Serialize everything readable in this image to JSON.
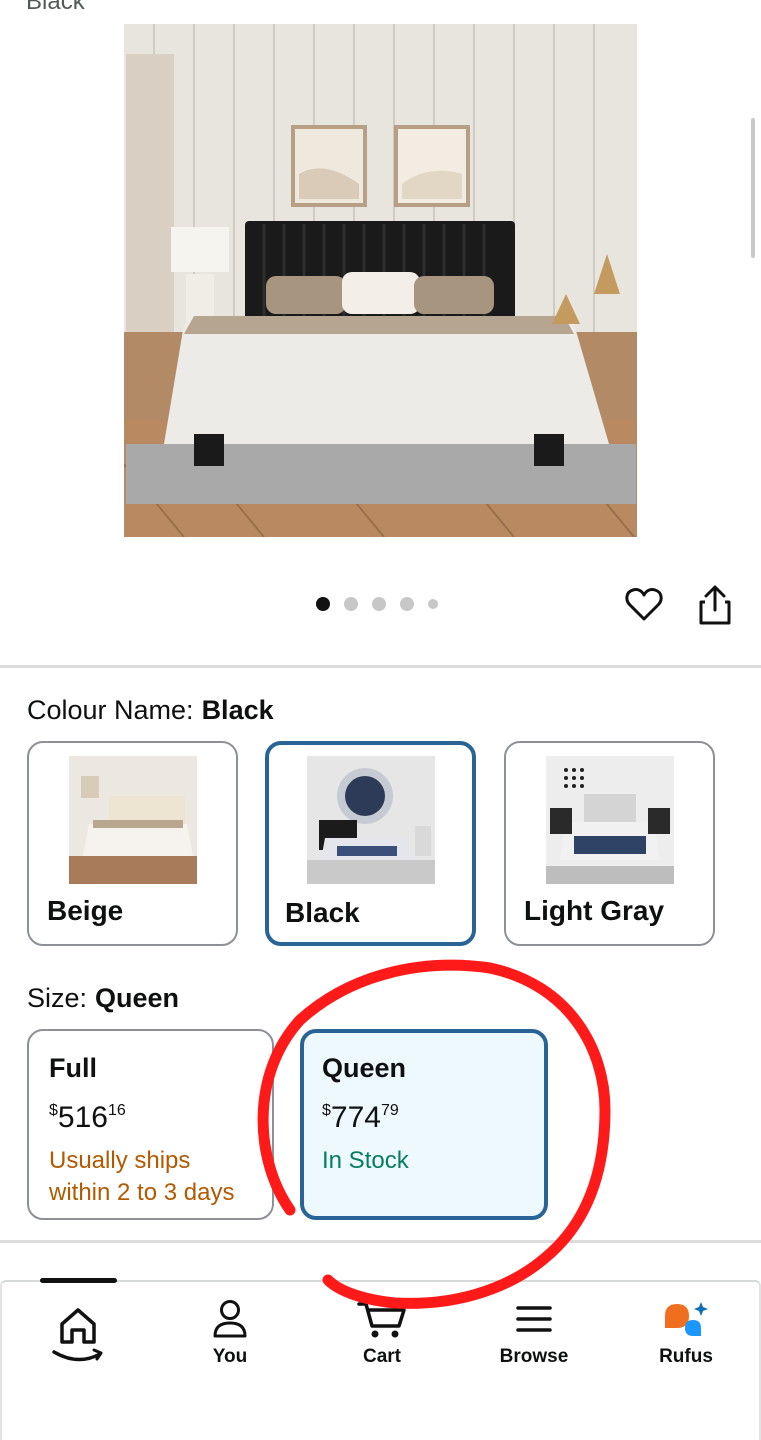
{
  "header": {
    "cut_off_text": "Black"
  },
  "gallery": {
    "image_count": 5,
    "active_index": 0
  },
  "actions": {
    "wishlist_icon": "heart-icon",
    "share_icon": "share-icon"
  },
  "colour": {
    "label": "Colour Name:",
    "selected": "Black",
    "options": [
      {
        "name": "Beige",
        "selected": false
      },
      {
        "name": "Black",
        "selected": true
      },
      {
        "name": "Light Gray",
        "selected": false
      }
    ]
  },
  "size": {
    "label": "Size:",
    "selected": "Queen",
    "options": [
      {
        "name": "Full",
        "price_whole": "516",
        "price_fraction": "16",
        "currency": "$",
        "status": "Usually ships within 2 to 3 days",
        "status_color": "#b35900",
        "selected": false
      },
      {
        "name": "Queen",
        "price_whole": "774",
        "price_fraction": "79",
        "currency": "$",
        "status": "In Stock",
        "status_color": "#067d62",
        "selected": true
      }
    ]
  },
  "tabbar": {
    "tabs": [
      {
        "label": "",
        "icon": "home-icon",
        "active": true
      },
      {
        "label": "You",
        "icon": "person-icon"
      },
      {
        "label": "Cart",
        "icon": "cart-icon"
      },
      {
        "label": "Browse",
        "icon": "menu-icon"
      },
      {
        "label": "Rufus",
        "icon": "rufus-icon"
      }
    ]
  },
  "colors": {
    "accent_border": "#2a6496",
    "selected_bg": "#edf8ff",
    "annotation": "#ff1a1a"
  }
}
